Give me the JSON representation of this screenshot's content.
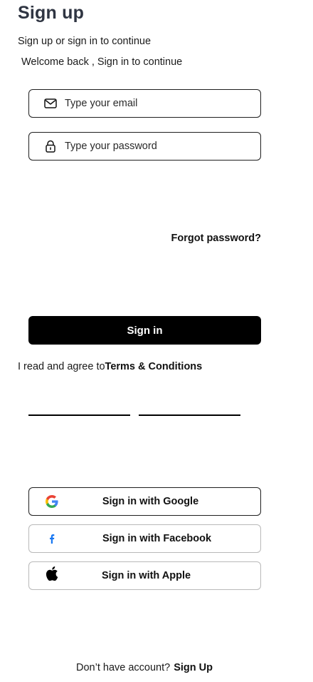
{
  "header": {
    "title": "Sign up",
    "subtitle": "Sign up or sign in to continue",
    "welcome": "Welcome back , Sign in to continue"
  },
  "form": {
    "email_placeholder": "Type your email",
    "email_icon": "mail-icon",
    "password_placeholder": "Type your password",
    "password_icon": "lock-icon",
    "forgot_label": "Forgot password?",
    "signin_label": "Sign in"
  },
  "terms": {
    "prefix": "I read and agree to",
    "link_label": "Terms & Conditions"
  },
  "social": [
    {
      "label": "Sign in with Google",
      "icon": "google-icon"
    },
    {
      "label": "Sign in with Facebook",
      "icon": "facebook-icon"
    },
    {
      "label": "Sign in with Apple",
      "icon": "apple-icon"
    }
  ],
  "footer": {
    "question": "Don’t have account?",
    "signup_label": "Sign Up"
  },
  "colors": {
    "primary_button": "#000000",
    "title": "#2f3542",
    "border": "#1f1f1f",
    "social_border": "#b9b9b9"
  }
}
